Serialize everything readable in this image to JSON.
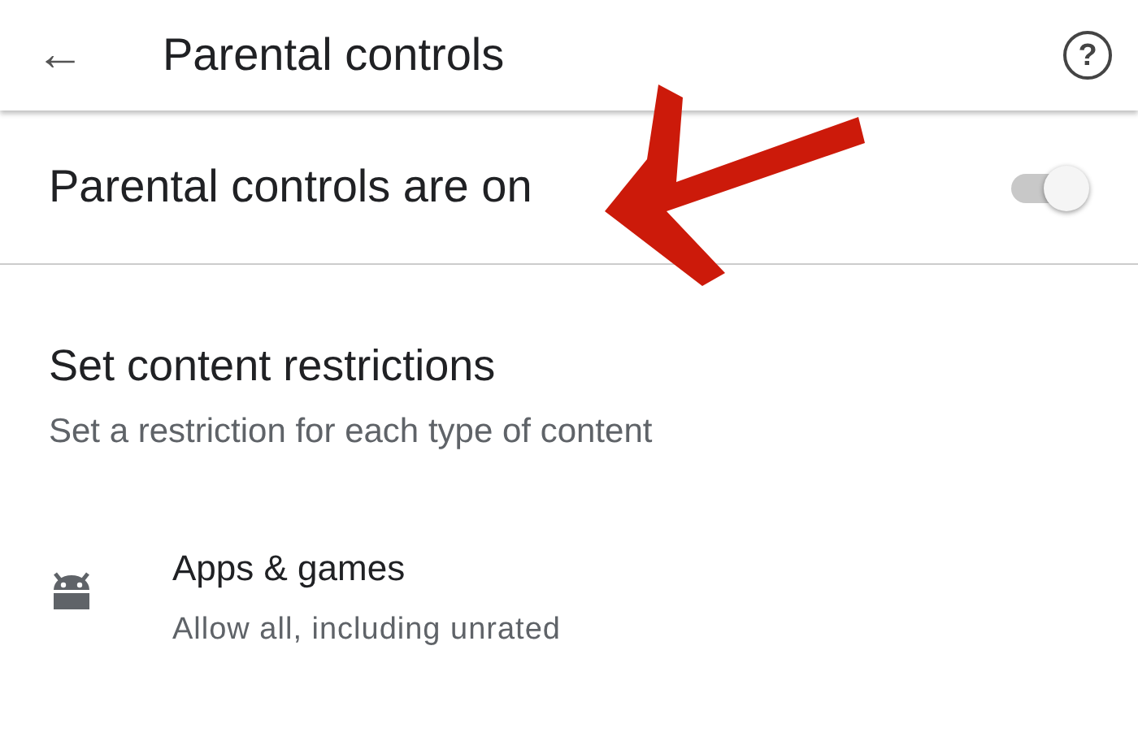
{
  "app_bar": {
    "back": "←",
    "title": "Parental controls",
    "help": "?"
  },
  "master_switch": {
    "label": "Parental controls are on",
    "on": true,
    "disabled": true
  },
  "section": {
    "title": "Set content restrictions",
    "subtitle": "Set a restriction for each type of content"
  },
  "items": [
    {
      "kind": "android",
      "title": "Apps & games",
      "summary": "Allow all, including unrated"
    }
  ],
  "annotation": {
    "kind": "arrow"
  }
}
